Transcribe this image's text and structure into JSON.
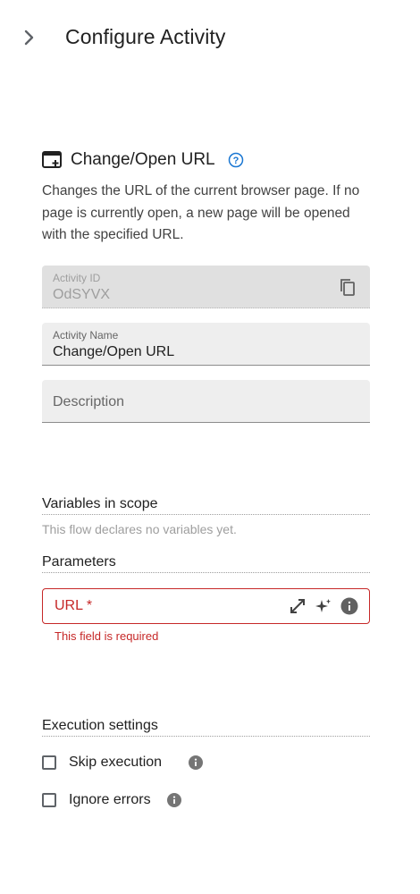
{
  "header": {
    "title": "Configure Activity",
    "collapse_icon": "chevron-right-icon"
  },
  "activity": {
    "icon": "browser-add-icon",
    "title": "Change/Open URL",
    "help_icon": "help-circle-icon",
    "description": "Changes the URL of the current browser page. If no page is currently open, a new page will be opened with the specified URL."
  },
  "fields": {
    "activity_id": {
      "label": "Activity ID",
      "value": "OdSYVX"
    },
    "activity_name": {
      "label": "Activity Name",
      "value": "Change/Open URL"
    },
    "description": {
      "placeholder": "Description"
    }
  },
  "variables": {
    "header": "Variables in scope",
    "empty_text": "This flow declares no variables yet."
  },
  "parameters": {
    "header": "Parameters",
    "url": {
      "label": "URL *",
      "error": "This field is required"
    }
  },
  "execution": {
    "header": "Execution settings",
    "skip": {
      "label": "Skip execution",
      "checked": false
    },
    "ignore": {
      "label": "Ignore errors",
      "checked": false
    }
  },
  "colors": {
    "error": "#c62828",
    "help_blue": "#1976d2"
  }
}
